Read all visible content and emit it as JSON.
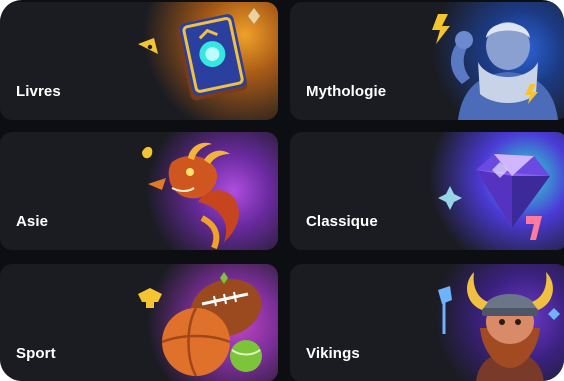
{
  "categories": [
    {
      "label": "Livres",
      "icon": "magic-book-icon",
      "accent": "#f0a12a"
    },
    {
      "label": "Mythologie",
      "icon": "zeus-icon",
      "accent": "#2d64d8"
    },
    {
      "label": "Asie",
      "icon": "dragon-icon",
      "accent": "#b04ee0"
    },
    {
      "label": "Classique",
      "icon": "gem-icon",
      "accent": "#2ee0d0"
    },
    {
      "label": "Sport",
      "icon": "sports-balls-icon",
      "accent": "#c446c8"
    },
    {
      "label": "Vikings",
      "icon": "viking-icon",
      "accent": "#6b39c8"
    }
  ]
}
